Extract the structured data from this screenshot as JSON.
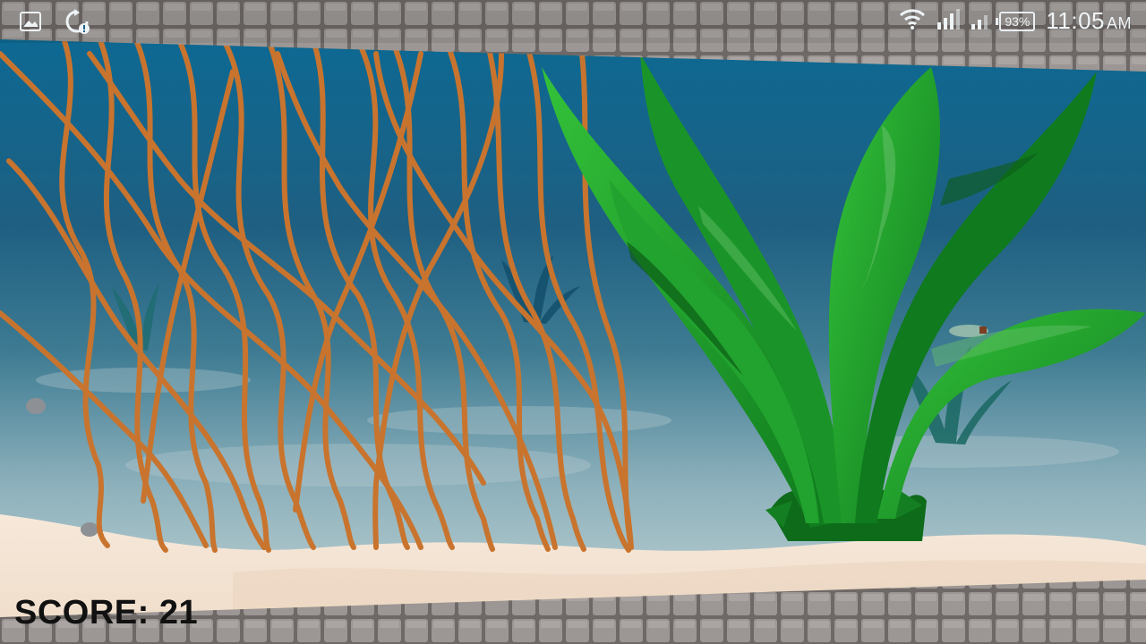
{
  "status_bar": {
    "time": "11:05",
    "ampm": "AM",
    "battery_percent": "93%",
    "left_icons": [
      "image-icon",
      "sync-alert-icon"
    ],
    "right_icons": [
      "wifi-icon",
      "signal-icon",
      "signal-secondary-icon",
      "battery-icon"
    ]
  },
  "hud": {
    "score_label": "SCORE: 21"
  },
  "colors": {
    "water_top": "#0a6e9a",
    "water_mid": "#3f7f98",
    "sand": "#f3e3d2",
    "brick": "#8e8a88",
    "seaweed_green": "#1e9c2a",
    "vine_brown": "#c8742e"
  }
}
